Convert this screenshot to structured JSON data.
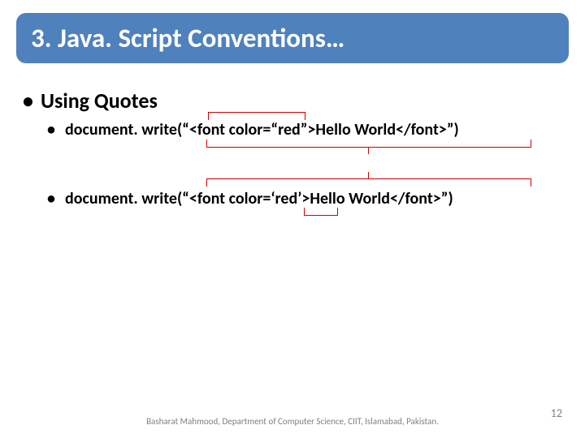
{
  "title": "3. Java. Script Conventions…",
  "heading": "Using Quotes",
  "line1": "document. write(“<font color=“red”>Hello World</font>”)",
  "line2": "document. write(“<font color=‘red’>Hello World</font>”)",
  "footer_center": "Basharat Mahmood, Department of Computer Science, CIIT, Islamabad, Pakistan.",
  "page_number": "12"
}
